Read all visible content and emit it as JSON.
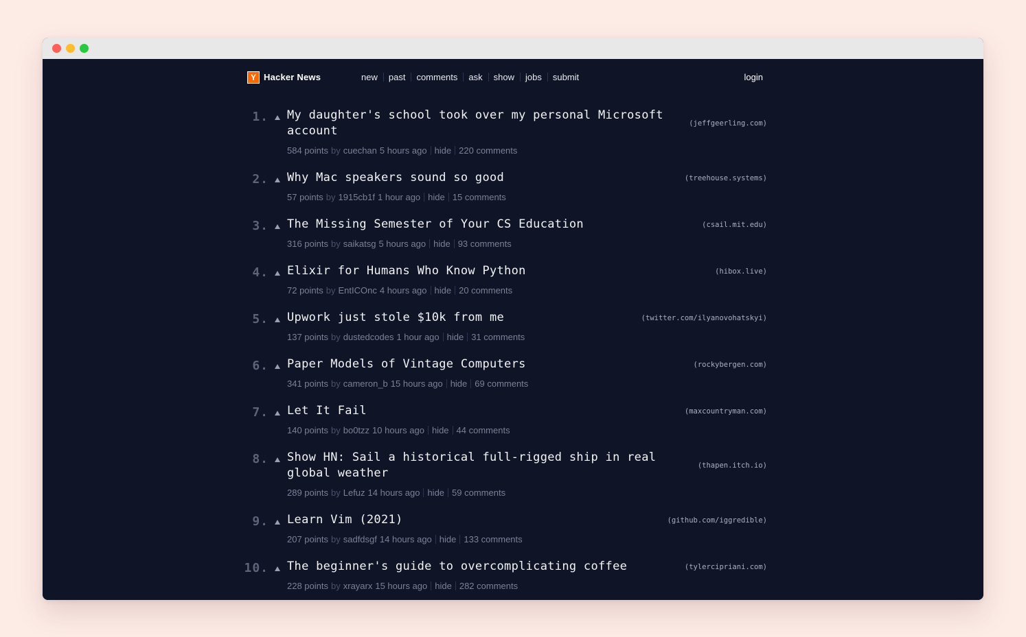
{
  "header": {
    "logo_letter": "Y",
    "site_name": "Hacker News",
    "nav": [
      "new",
      "past",
      "comments",
      "ask",
      "show",
      "jobs",
      "submit"
    ],
    "login": "login"
  },
  "labels": {
    "by": "by",
    "hide": "hide"
  },
  "stories": [
    {
      "rank": "1.",
      "title": "My daughter's school took over my personal Microsoft account",
      "domain": "(jeffgeerling.com)",
      "points": "584 points",
      "user": "cuechan",
      "age": "5 hours ago",
      "comments": "220 comments"
    },
    {
      "rank": "2.",
      "title": "Why Mac speakers sound so good",
      "domain": "(treehouse.systems)",
      "points": "57 points",
      "user": "1915cb1f",
      "age": "1 hour ago",
      "comments": "15 comments"
    },
    {
      "rank": "3.",
      "title": "The Missing Semester of Your CS Education",
      "domain": "(csail.mit.edu)",
      "points": "316 points",
      "user": "saikatsg",
      "age": "5 hours ago",
      "comments": "93 comments"
    },
    {
      "rank": "4.",
      "title": "Elixir for Humans Who Know Python",
      "domain": "(hibox.live)",
      "points": "72 points",
      "user": "EntICOnc",
      "age": "4 hours ago",
      "comments": "20 comments"
    },
    {
      "rank": "5.",
      "title": "Upwork just stole $10k from me",
      "domain": "(twitter.com/ilyanovohatskyi)",
      "points": "137 points",
      "user": "dustedcodes",
      "age": "1 hour ago",
      "comments": "31 comments"
    },
    {
      "rank": "6.",
      "title": "Paper Models of Vintage Computers",
      "domain": "(rockybergen.com)",
      "points": "341 points",
      "user": "cameron_b",
      "age": "15 hours ago",
      "comments": "69 comments"
    },
    {
      "rank": "7.",
      "title": "Let It Fail",
      "domain": "(maxcountryman.com)",
      "points": "140 points",
      "user": "bo0tzz",
      "age": "10 hours ago",
      "comments": "44 comments"
    },
    {
      "rank": "8.",
      "title": "Show HN: Sail a historical full-rigged ship in real global weather",
      "domain": "(thapen.itch.io)",
      "points": "289 points",
      "user": "Lefuz",
      "age": "14 hours ago",
      "comments": "59 comments"
    },
    {
      "rank": "9.",
      "title": "Learn Vim (2021)",
      "domain": "(github.com/iggredible)",
      "points": "207 points",
      "user": "sadfdsgf",
      "age": "14 hours ago",
      "comments": "133 comments"
    },
    {
      "rank": "10.",
      "title": "The beginner's guide to overcomplicating coffee",
      "domain": "(tylercipriani.com)",
      "points": "228 points",
      "user": "xrayarx",
      "age": "15 hours ago",
      "comments": "282 comments"
    }
  ]
}
